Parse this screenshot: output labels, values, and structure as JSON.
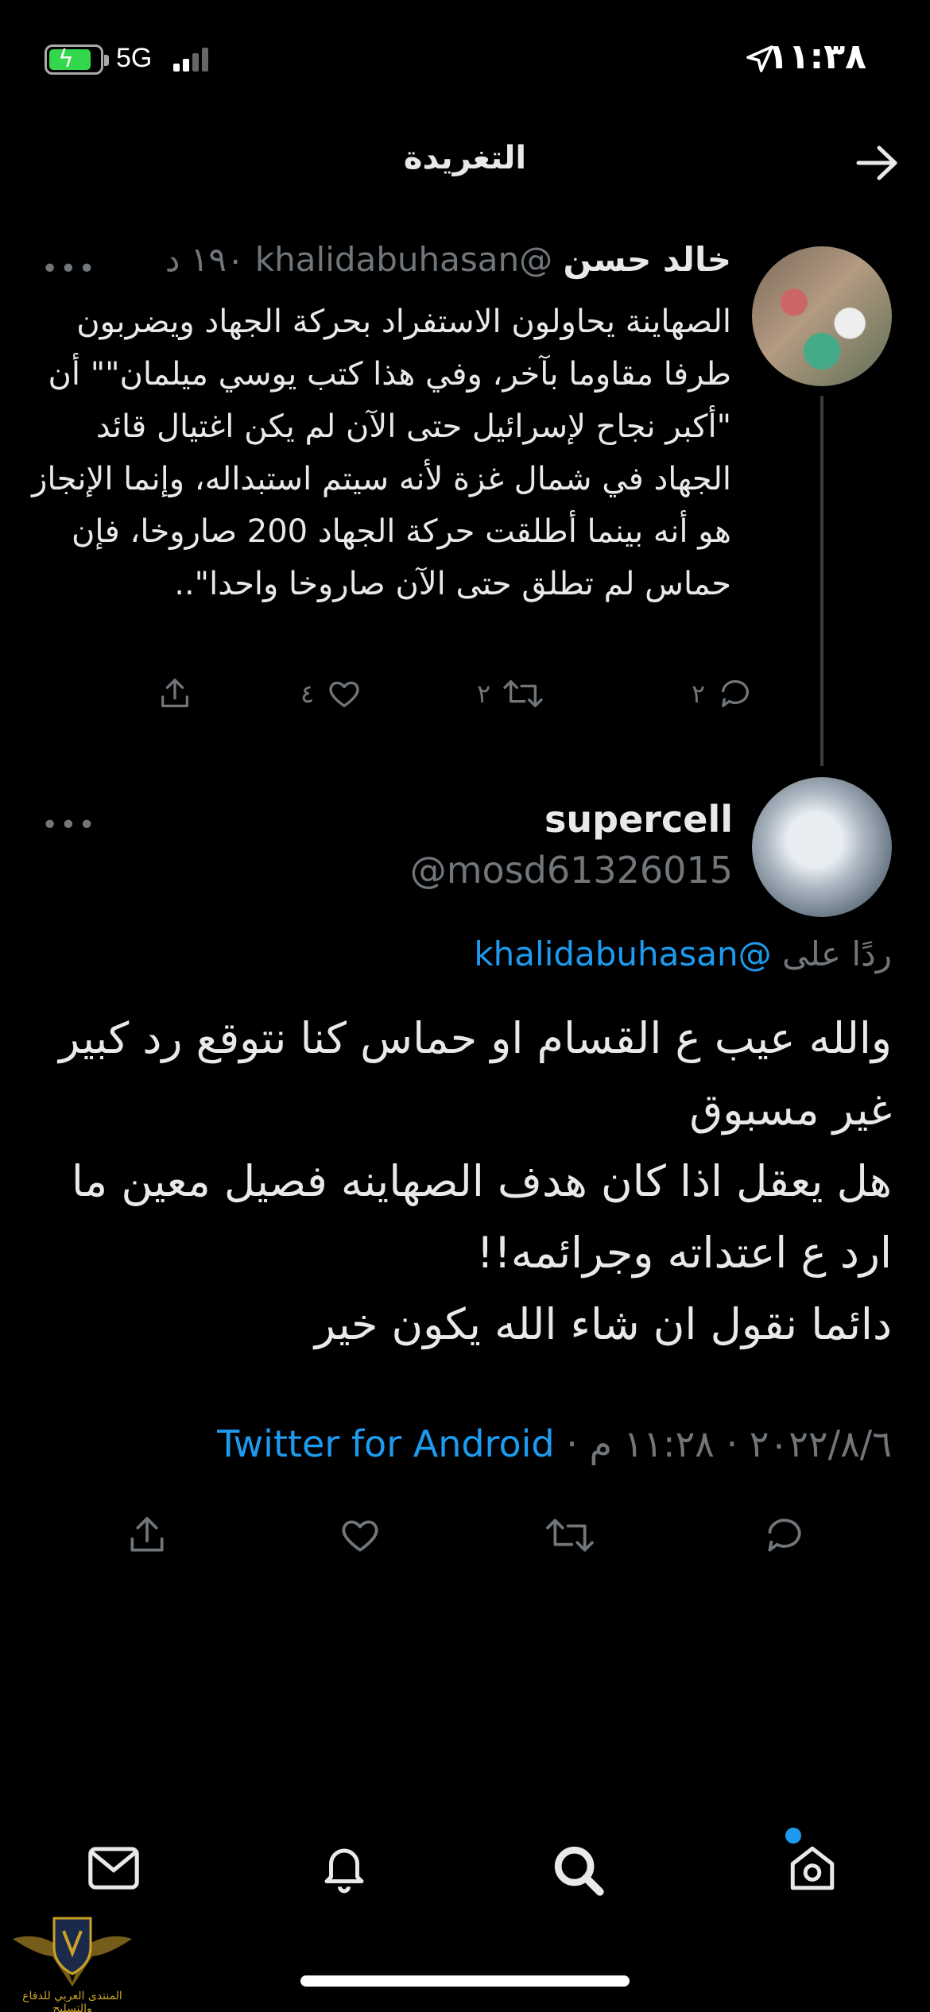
{
  "status_bar": {
    "network": "5G",
    "time": "١١:٣٨"
  },
  "header": {
    "title": "التغريدة"
  },
  "parent_tweet": {
    "name": "خالد حسن",
    "handle": "@khalidabuhasan",
    "age": "١٩٠ د",
    "text": "الصهاينة يحاولون الاستفراد بحركة الجهاد ويضربون طرفا مقاوما بآخر، وفي هذا كتب يوسي ميلمان\"\" أن \"أكبر نجاح لإسرائيل حتى الآن لم يكن اغتيال قائد الجهاد في شمال غزة لأنه سيتم استبداله، وإنما الإنجاز هو أنه بينما أطلقت حركة الجهاد 200 صاروخا، فإن حماس لم تطلق حتى الآن صاروخا واحدا\"..",
    "replies": "٢",
    "retweets": "٢",
    "likes": "٤"
  },
  "reply_tweet": {
    "name": "supercell",
    "handle": "@mosd61326015",
    "reply_prefix": "ردًا على",
    "reply_to": "@khalidabuhasan",
    "text": "والله عيب ع القسام او حماس كنا نتوقع رد كبير غير مسبوق\nهل يعقل اذا كان هدف الصهاينه فصيل معين ما ارد ع اعتداته وجرائمه!!\nدائما نقول ان شاء الله يكون خير",
    "timestamp": "٢٠٢٢/٨/٦ · ١١:٢٨ م · ",
    "source": "Twitter for Android"
  },
  "more_glyph": "•••",
  "watermark": {
    "text": "المنتدى العربي للدفاع والتسليح"
  },
  "colors": {
    "background": "#000000",
    "text": "#e7e9ea",
    "secondary": "#71767b",
    "accent": "#1d9bf0"
  },
  "icons": [
    "battery-icon",
    "signal-icon",
    "location-icon",
    "back-arrow-icon",
    "more-icon",
    "reply-icon",
    "retweet-icon",
    "like-icon",
    "share-icon",
    "home-icon",
    "search-icon",
    "notifications-icon",
    "messages-icon"
  ]
}
